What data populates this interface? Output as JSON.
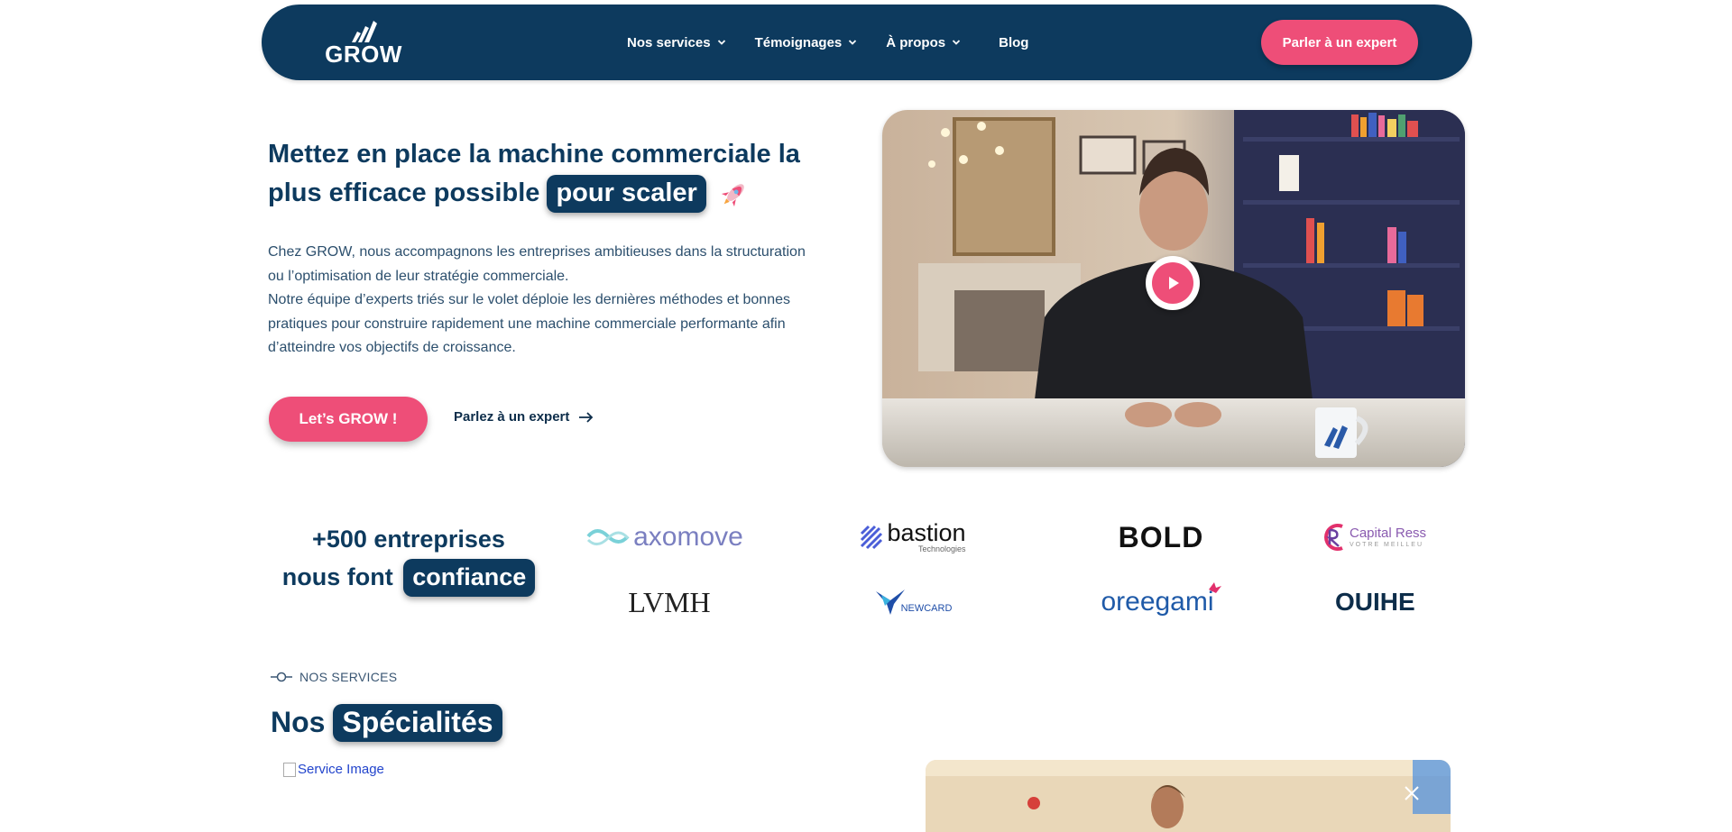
{
  "nav": {
    "logo_text": "GROW",
    "items": [
      {
        "label": "Nos services",
        "has_chevron": true
      },
      {
        "label": "Témoignages",
        "has_chevron": true
      },
      {
        "label": "À propos",
        "has_chevron": true
      },
      {
        "label": "Blog",
        "has_chevron": false
      }
    ],
    "cta_label": "Parler à un expert"
  },
  "hero": {
    "title_part1": "Mettez en place la machine commerciale la plus efficace possible",
    "title_highlight": "pour scaler",
    "title_emoji": "rocket-icon",
    "paragraph1": "Chez GROW, nous accompagnons les entreprises ambitieuses dans la structuration ou l’optimisation de leur stratégie commerciale.",
    "paragraph2": "Notre équipe d’experts triés sur le volet déploie les dernières méthodes et bonnes pratiques pour construire rapidement une machine commerciale performante afin d’atteindre vos objectifs de croissance.",
    "primary_button": "Let’s GROW !",
    "secondary_link": "Parlez à un expert"
  },
  "video": {
    "play_icon": "play-icon"
  },
  "trust": {
    "line1": "+500 entreprises",
    "line2_prefix": "nous font",
    "highlight": "confiance",
    "logos": [
      {
        "name": "axomove"
      },
      {
        "name": "bastion",
        "sub": "Technologies"
      },
      {
        "name": "BOLD"
      },
      {
        "name": "Capital Ress",
        "sub": "VOTRE MEILLEU"
      },
      {
        "name": "LVMH"
      },
      {
        "name": "NEWCARD"
      },
      {
        "name": "oreegami"
      },
      {
        "name": "OUIHE"
      }
    ]
  },
  "services": {
    "label": "NOS SERVICES",
    "title_prefix": "Nos",
    "title_highlight": "Spécialités",
    "image_alt": "Service Image"
  },
  "colors": {
    "navy": "#0d3a5e",
    "pink": "#ee4e78"
  }
}
